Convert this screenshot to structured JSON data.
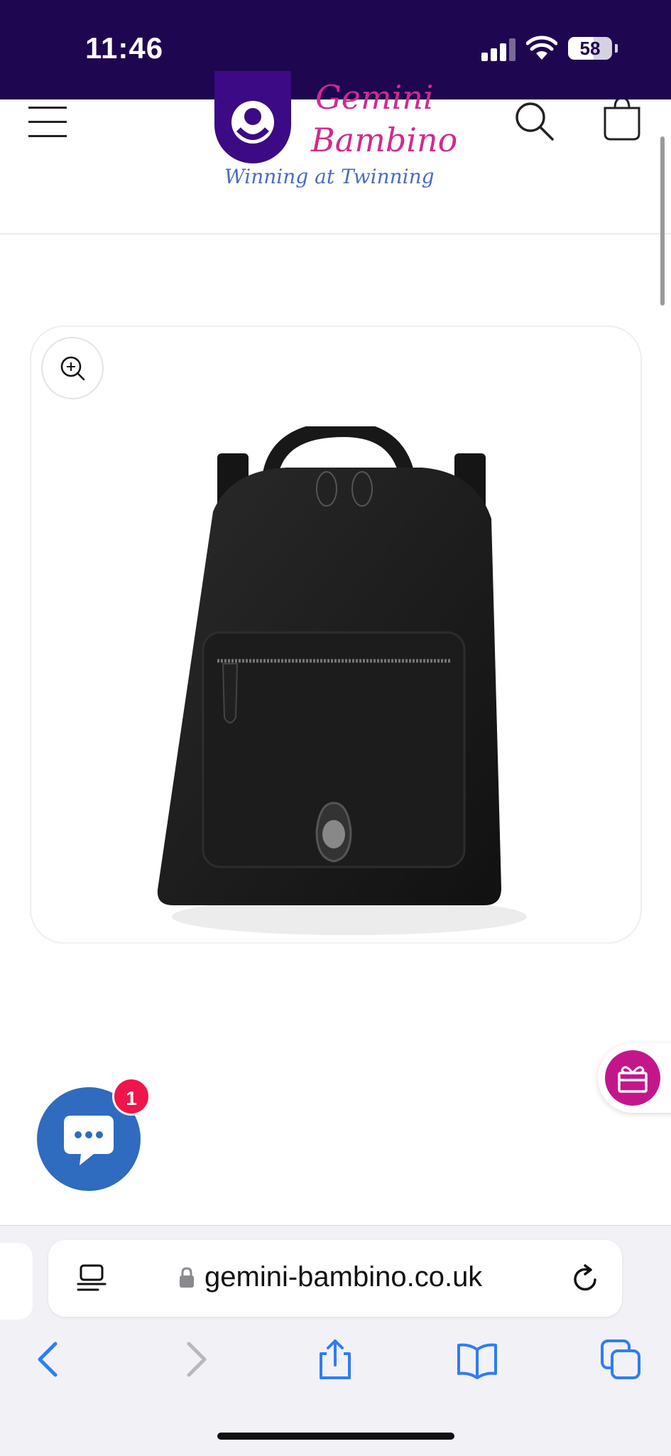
{
  "status_bar": {
    "time": "11:46",
    "battery_percent": "58",
    "battery_level": 0.58
  },
  "header": {
    "logo": {
      "name_line1": "Gemini",
      "name_line2": "Bambino",
      "tagline": "Winning at Twinning"
    },
    "icons": [
      "menu-icon",
      "search-icon",
      "cart-icon"
    ]
  },
  "product": {
    "zoom_icon": "zoom-in-icon",
    "image_subject": "black leather backpack"
  },
  "widgets": {
    "chat_unread_count": "1",
    "gift_icon": "gift-icon"
  },
  "browser": {
    "url": "gemini-bambino.co.uk",
    "toolbar": [
      "back-icon",
      "forward-icon",
      "share-icon",
      "bookmarks-icon",
      "tabs-icon"
    ]
  },
  "colors": {
    "status_bar_bg": "#1f0650",
    "brand_purple": "#3b0a84",
    "brand_pink": "#d12a8f",
    "chat_blue": "#2f6bbf",
    "badge_red": "#f0154b",
    "safari_blue": "#2f7cf6"
  }
}
